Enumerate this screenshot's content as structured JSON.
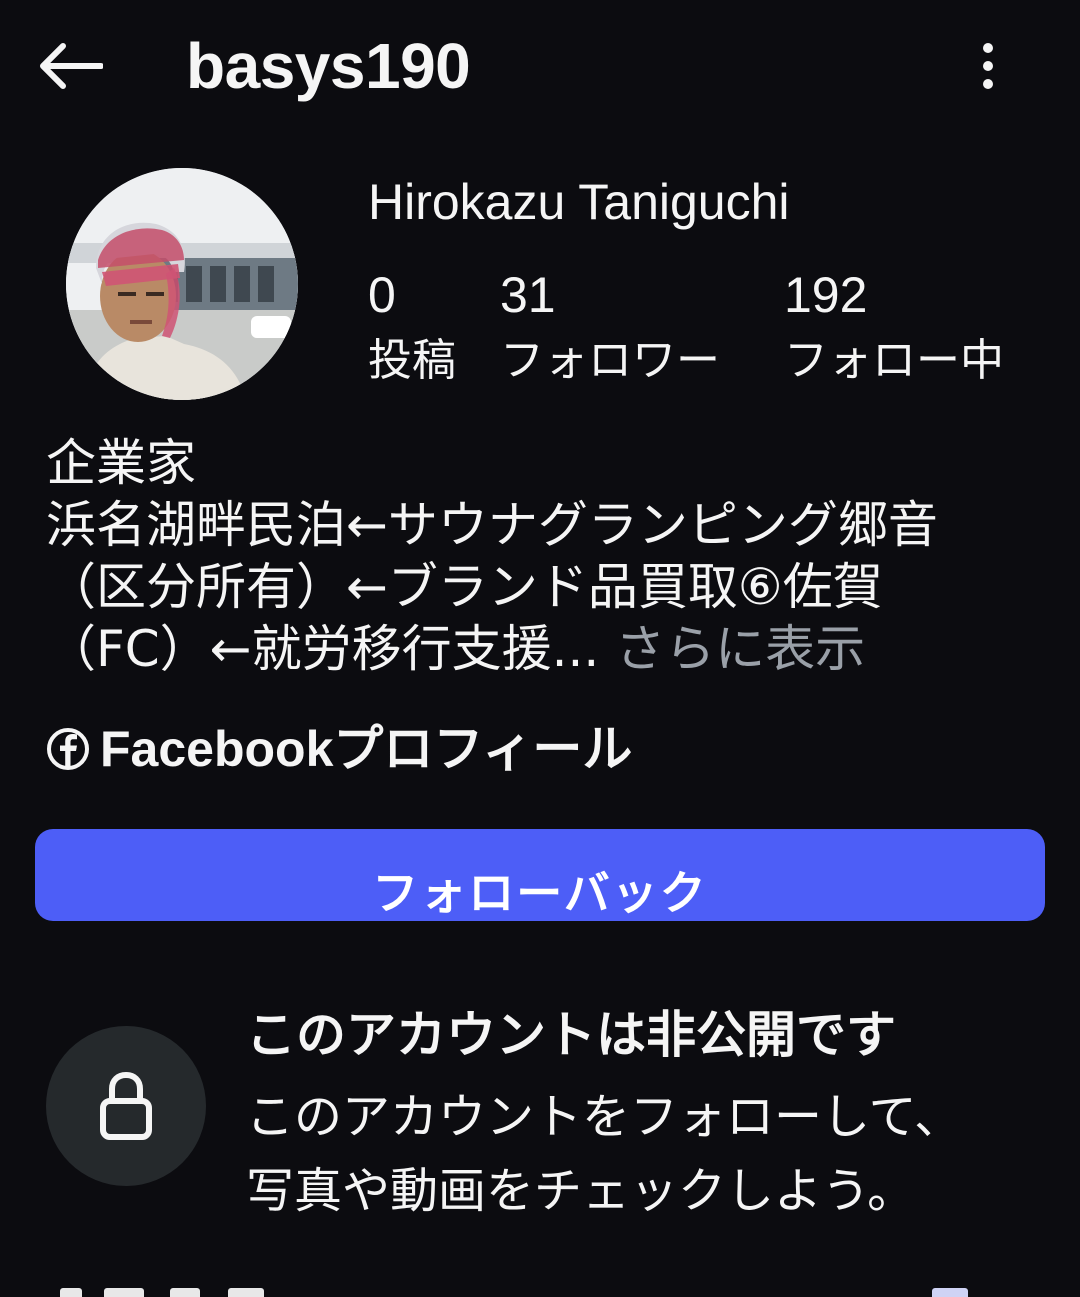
{
  "header": {
    "username": "basys190",
    "back_icon": "arrow-left-icon",
    "more_icon": "more-vertical-icon"
  },
  "profile": {
    "display_name": "Hirokazu Taniguchi",
    "stats": [
      {
        "value": "0",
        "label": "投稿"
      },
      {
        "value": "31",
        "label": "フォロワー"
      },
      {
        "value": "192",
        "label": "フォロー中"
      }
    ],
    "bio": {
      "lines": [
        "企業家",
        "浜名湖畔民泊←サウナグランピング郷音",
        "（区分所有）←ブランド品買取⑥佐賀",
        "（FC）←就労移行支援..."
      ],
      "more_label": "さらに表示"
    },
    "facebook_link": {
      "icon": "facebook-icon",
      "label": "Facebookプロフィール"
    }
  },
  "follow_back_button": {
    "label": "フォローバック",
    "color": "#4d5ef7"
  },
  "private_notice": {
    "icon": "lock-icon",
    "title": "このアカウントは非公開です",
    "description_lines": [
      "このアカウントをフォローして、",
      "写真や動画をチェックしよう。"
    ]
  },
  "colors": {
    "background": "#0c0c10",
    "text": "#f5f5f5",
    "muted": "#9aa0a8",
    "lock_circle": "#25292c"
  }
}
